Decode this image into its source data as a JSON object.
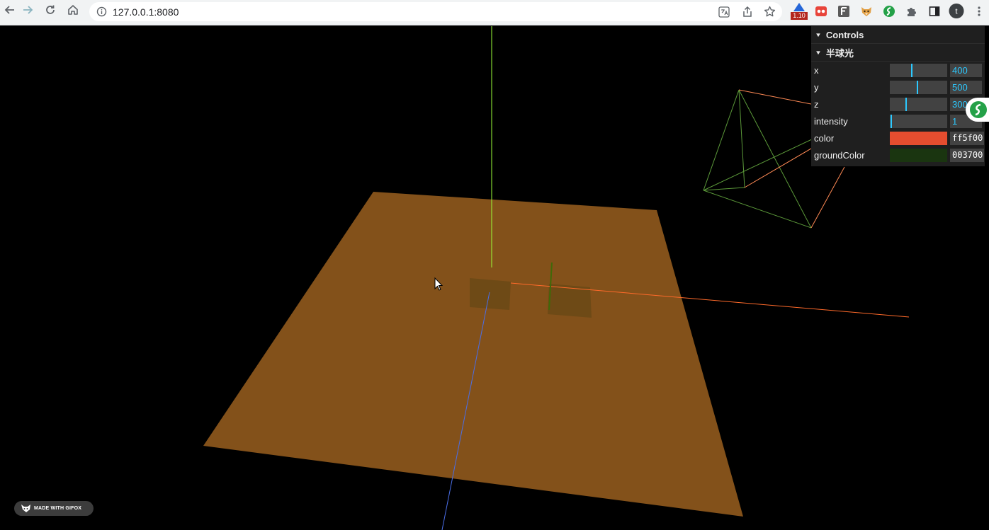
{
  "browser": {
    "url": "127.0.0.1:8080",
    "extension_badge": "1.10"
  },
  "gui": {
    "title": "Controls",
    "folder": {
      "title": "半球光",
      "controls": [
        {
          "label": "x",
          "value": "400",
          "fraction": 0.38
        },
        {
          "label": "y",
          "value": "500",
          "fraction": 0.48
        },
        {
          "label": "z",
          "value": "300",
          "fraction": 0.28
        },
        {
          "label": "intensity",
          "value": "1",
          "fraction": 0.01
        }
      ],
      "colors": [
        {
          "label": "color",
          "hex": "ff5f00",
          "swatch": "#e54d2f"
        },
        {
          "label": "groundColor",
          "hex": "003700",
          "swatch": "#1a3510"
        }
      ]
    }
  },
  "watermark": "MADE WITH GIFOX",
  "scene_colors": {
    "background": "#000000",
    "plane": "#83511a",
    "axis_x": "#ff6a2a",
    "axis_y": "#9cff3a",
    "axis_z": "#4a6ee8"
  }
}
